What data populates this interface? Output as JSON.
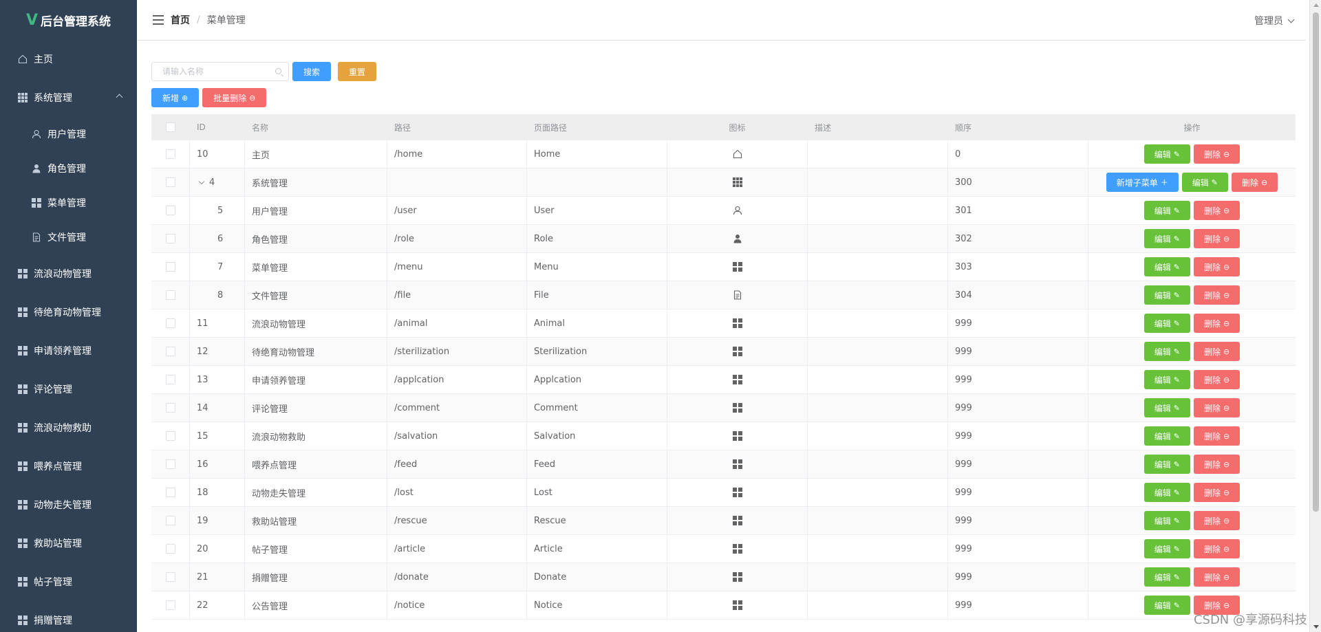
{
  "app": {
    "logo_mark": "V",
    "title": "后台管理系统"
  },
  "sidebar": {
    "items": [
      {
        "label": "主页",
        "icon": "house-icon"
      },
      {
        "label": "系统管理",
        "icon": "grid-icon",
        "expanded": true,
        "children": [
          {
            "label": "用户管理",
            "icon": "user-icon"
          },
          {
            "label": "角色管理",
            "icon": "user-solid-icon"
          },
          {
            "label": "菜单管理",
            "icon": "menu-icon"
          },
          {
            "label": "文件管理",
            "icon": "document-icon"
          }
        ]
      },
      {
        "label": "流浪动物管理",
        "icon": "menu-icon"
      },
      {
        "label": "待绝育动物管理",
        "icon": "menu-icon"
      },
      {
        "label": "申请领养管理",
        "icon": "menu-icon"
      },
      {
        "label": "评论管理",
        "icon": "menu-icon"
      },
      {
        "label": "流浪动物救助",
        "icon": "menu-icon"
      },
      {
        "label": "喂养点管理",
        "icon": "menu-icon"
      },
      {
        "label": "动物走失管理",
        "icon": "menu-icon"
      },
      {
        "label": "救助站管理",
        "icon": "menu-icon"
      },
      {
        "label": "帖子管理",
        "icon": "menu-icon"
      },
      {
        "label": "捐赠管理",
        "icon": "menu-icon"
      }
    ]
  },
  "header": {
    "breadcrumb": {
      "home": "首页",
      "separator": "/",
      "current": "菜单管理"
    },
    "user": "管理员"
  },
  "search": {
    "placeholder": "请输入名称",
    "value": ""
  },
  "buttons": {
    "search": "搜索",
    "reset": "重置",
    "add": "新增",
    "batch_delete": "批量删除",
    "edit": "编辑",
    "delete": "删除",
    "add_child": "新增子菜单"
  },
  "table": {
    "columns": [
      "ID",
      "名称",
      "路径",
      "页面路径",
      "图标",
      "描述",
      "顺序",
      "操作"
    ],
    "rows": [
      {
        "id": "10",
        "name": "主页",
        "path": "/home",
        "page_path": "Home",
        "icon": "house-icon",
        "desc": "",
        "order": "0",
        "level": 0
      },
      {
        "id": "4",
        "name": "系统管理",
        "path": "",
        "page_path": "",
        "icon": "grid-icon",
        "desc": "",
        "order": "300",
        "level": 0,
        "parent": true
      },
      {
        "id": "5",
        "name": "用户管理",
        "path": "/user",
        "page_path": "User",
        "icon": "user-icon",
        "desc": "",
        "order": "301",
        "level": 1
      },
      {
        "id": "6",
        "name": "角色管理",
        "path": "/role",
        "page_path": "Role",
        "icon": "user-solid-icon",
        "desc": "",
        "order": "302",
        "level": 1
      },
      {
        "id": "7",
        "name": "菜单管理",
        "path": "/menu",
        "page_path": "Menu",
        "icon": "menu-icon",
        "desc": "",
        "order": "303",
        "level": 1
      },
      {
        "id": "8",
        "name": "文件管理",
        "path": "/file",
        "page_path": "File",
        "icon": "document-icon",
        "desc": "",
        "order": "304",
        "level": 1
      },
      {
        "id": "11",
        "name": "流浪动物管理",
        "path": "/animal",
        "page_path": "Animal",
        "icon": "menu-icon",
        "desc": "",
        "order": "999",
        "level": 0
      },
      {
        "id": "12",
        "name": "待绝育动物管理",
        "path": "/sterilization",
        "page_path": "Sterilization",
        "icon": "menu-icon",
        "desc": "",
        "order": "999",
        "level": 0
      },
      {
        "id": "13",
        "name": "申请领养管理",
        "path": "/applcation",
        "page_path": "Applcation",
        "icon": "menu-icon",
        "desc": "",
        "order": "999",
        "level": 0
      },
      {
        "id": "14",
        "name": "评论管理",
        "path": "/comment",
        "page_path": "Comment",
        "icon": "menu-icon",
        "desc": "",
        "order": "999",
        "level": 0
      },
      {
        "id": "15",
        "name": "流浪动物救助",
        "path": "/salvation",
        "page_path": "Salvation",
        "icon": "menu-icon",
        "desc": "",
        "order": "999",
        "level": 0
      },
      {
        "id": "16",
        "name": "喂养点管理",
        "path": "/feed",
        "page_path": "Feed",
        "icon": "menu-icon",
        "desc": "",
        "order": "999",
        "level": 0
      },
      {
        "id": "18",
        "name": "动物走失管理",
        "path": "/lost",
        "page_path": "Lost",
        "icon": "menu-icon",
        "desc": "",
        "order": "999",
        "level": 0
      },
      {
        "id": "19",
        "name": "救助站管理",
        "path": "/rescue",
        "page_path": "Rescue",
        "icon": "menu-icon",
        "desc": "",
        "order": "999",
        "level": 0
      },
      {
        "id": "20",
        "name": "帖子管理",
        "path": "/article",
        "page_path": "Article",
        "icon": "menu-icon",
        "desc": "",
        "order": "999",
        "level": 0
      },
      {
        "id": "21",
        "name": "捐赠管理",
        "path": "/donate",
        "page_path": "Donate",
        "icon": "menu-icon",
        "desc": "",
        "order": "999",
        "level": 0
      },
      {
        "id": "22",
        "name": "公告管理",
        "path": "/notice",
        "page_path": "Notice",
        "icon": "menu-icon",
        "desc": "",
        "order": "999",
        "level": 0
      }
    ]
  },
  "watermark": "CSDN @享源码科技",
  "colors": {
    "sidebar_bg": "#304156",
    "primary": "#409eff",
    "success": "#67c23a",
    "danger": "#f56c6c",
    "warning": "#e6a23c",
    "logo": "#41b883"
  }
}
